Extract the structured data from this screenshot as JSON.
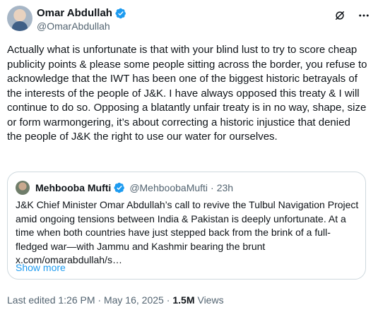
{
  "author": {
    "name": "Omar Abdullah",
    "handle": "@OmarAbdullah",
    "verified_color": "#1d9bf0"
  },
  "header_actions": [
    {
      "icon": "grok-icon"
    },
    {
      "icon": "more-icon",
      "label": "⋯"
    }
  ],
  "tweet": {
    "text": "Actually what is unfortunate is that with your blind lust to try to score cheap publicity points & please some people sitting across the border, you refuse to acknowledge that the IWT has been one of the biggest historic betrayals of the interests of the people of J&K. I have always opposed this treaty & I will continue to do so. Opposing a blatantly unfair treaty is in no way, shape, size or form warmongering, it’s about correcting a historic injustice that denied the people of J&K the right to use our water for ourselves."
  },
  "quote": {
    "name": "Mehbooba Mufti",
    "handle": "@MehboobaMufti",
    "separator": "·",
    "time": "23h",
    "text": "J&K Chief Minister Omar Abdullah’s call to revive the Tulbul Navigation Project amid ongoing tensions between India & Pakistan is deeply unfortunate. At a time when both countries have just stepped back from the brink of a full-fledged war—with Jammu and Kashmir bearing the brunt x.com/omarabdullah/s…",
    "show_more": "Show more"
  },
  "meta": {
    "edited": "Last edited 1:26 PM · May 16, 2025 ·",
    "views_count": "1.5M",
    "views_label": "Views"
  },
  "colors": {
    "text": "#0f1419",
    "secondary": "#536471",
    "link": "#1d9bf0",
    "border": "#cfd9de"
  }
}
